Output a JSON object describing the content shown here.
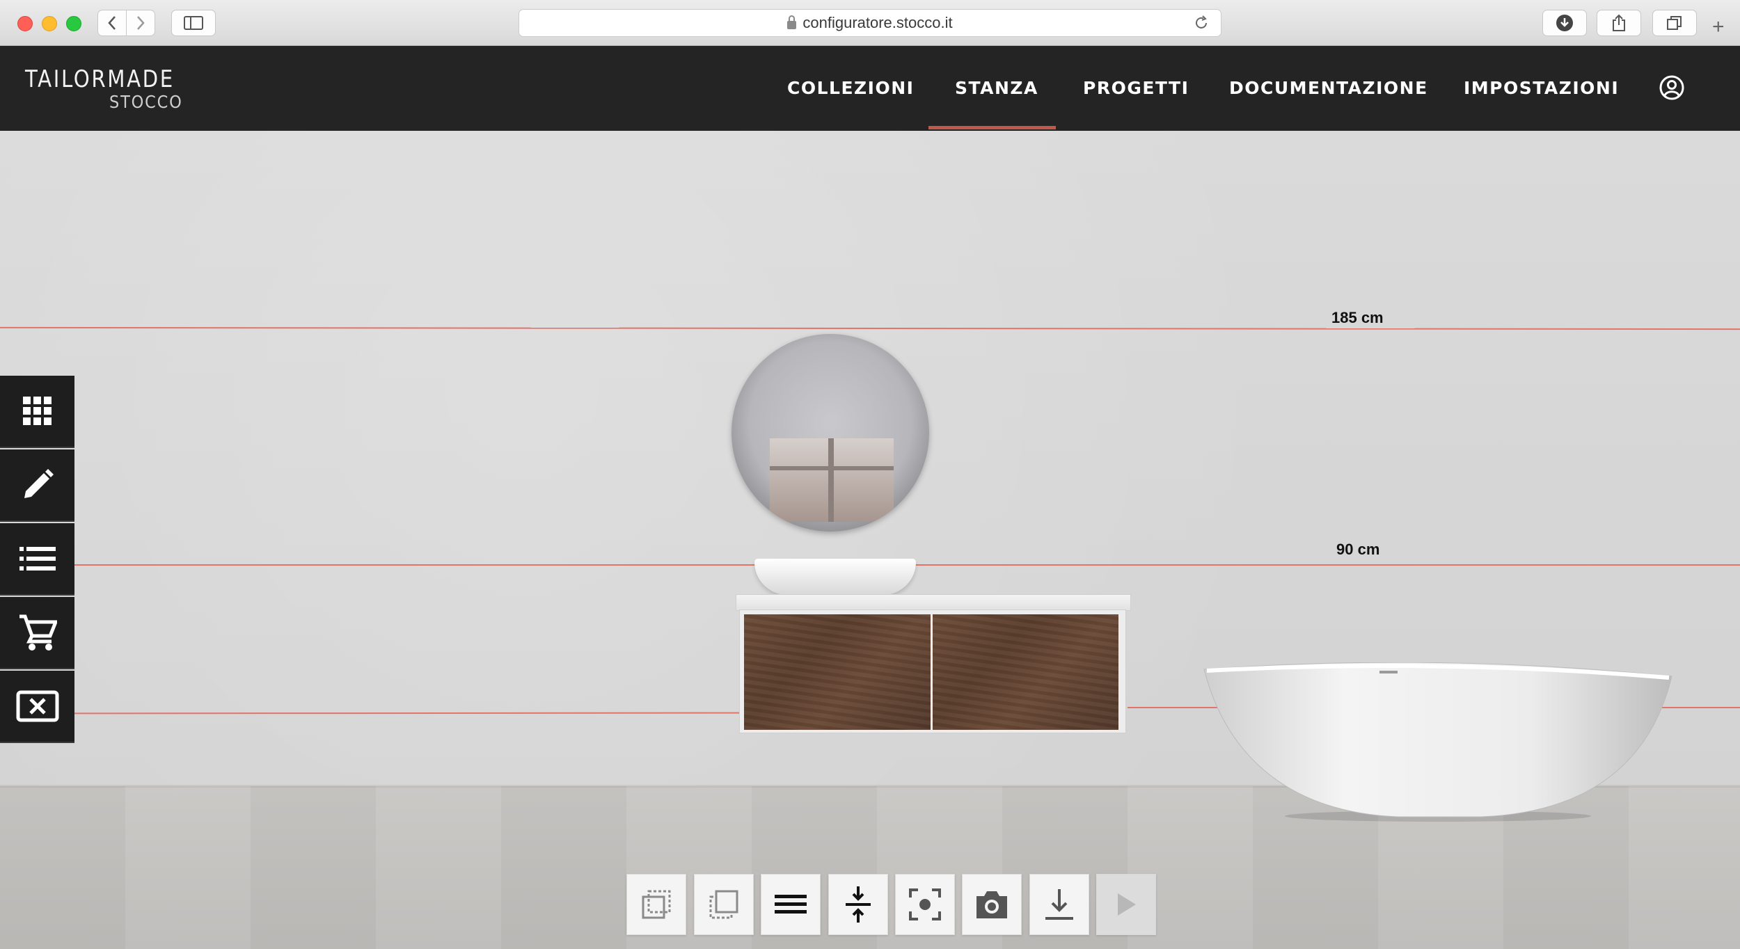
{
  "browser": {
    "url": "configuratore.stocco.it"
  },
  "brand": {
    "logo_top": "TAILORMADE",
    "logo_bottom": "STOCCO",
    "accent_color": "#c0594a",
    "header_bg": "#242424"
  },
  "nav": {
    "items": [
      {
        "label": "COLLEZIONI"
      },
      {
        "label": "STANZA",
        "active": true
      },
      {
        "label": "PROGETTI"
      },
      {
        "label": "DOCUMENTAZIONE"
      },
      {
        "label": "IMPOSTAZIONI"
      }
    ],
    "user_icon": "user-circle-icon"
  },
  "scene": {
    "dimension_labels": [
      "185 cm",
      "90 cm"
    ],
    "objects": [
      "round-mirror",
      "vessel-basin",
      "wall-cabinet",
      "freestanding-bathtub"
    ],
    "guide_line_color": "#e2746a"
  },
  "left_toolbar": [
    {
      "icon": "grid-icon"
    },
    {
      "icon": "pencil-icon"
    },
    {
      "icon": "list-icon"
    },
    {
      "icon": "cart-icon"
    },
    {
      "icon": "close-box-icon"
    }
  ],
  "bottom_toolbar": [
    {
      "icon": "select-back-icon"
    },
    {
      "icon": "select-front-icon"
    },
    {
      "icon": "menu-lines-icon"
    },
    {
      "icon": "align-compress-icon"
    },
    {
      "icon": "focus-icon"
    },
    {
      "icon": "camera-icon"
    },
    {
      "icon": "download-icon"
    },
    {
      "icon": "play-icon",
      "disabled": true
    }
  ]
}
